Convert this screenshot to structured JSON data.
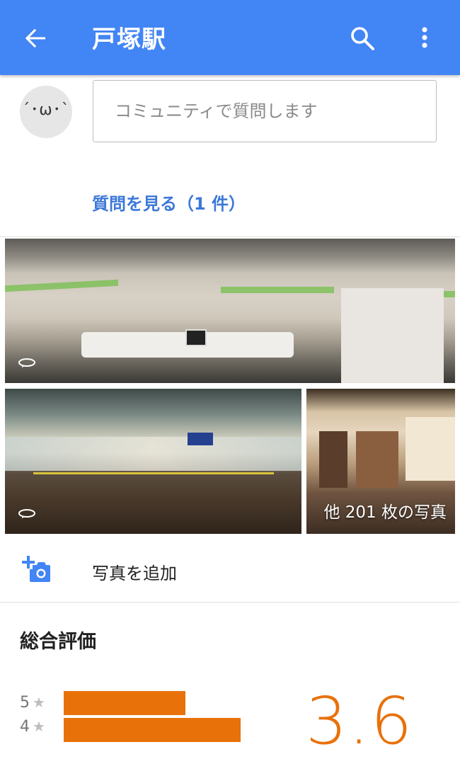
{
  "appbar": {
    "title": "戸塚駅",
    "icons": [
      "back-arrow-icon",
      "search-icon",
      "more-vert-icon"
    ],
    "color": "#4285f4"
  },
  "community": {
    "avatar_text": "´･ω･`",
    "input_placeholder": "コミュニティで質問します",
    "see_questions": "質問を見る（1 件）"
  },
  "photos": {
    "more_label": "他 201 枚の写真",
    "items": [
      {
        "type": "360-panorama",
        "icon": "panorama-icon"
      },
      {
        "type": "360-panorama",
        "icon": "panorama-icon"
      },
      {
        "type": "photo"
      }
    ]
  },
  "add_photo": {
    "label": "写真を追加",
    "icon": "add-photo-icon"
  },
  "rating": {
    "title": "総合評価",
    "average": "3.6",
    "accent": "#e8710a",
    "rows": [
      {
        "stars": "5",
        "fraction": 0.33
      },
      {
        "stars": "4",
        "fraction": 0.48
      }
    ]
  }
}
